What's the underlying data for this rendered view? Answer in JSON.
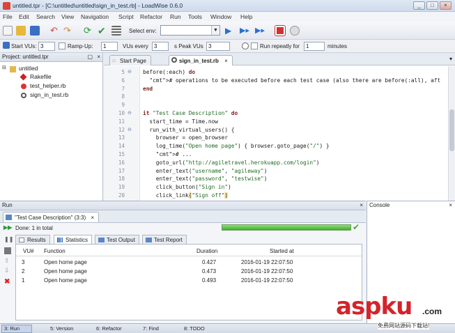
{
  "window": {
    "title": "untitled.tpr - [C:\\untitled\\untitled\\sign_in_test.rb] - LoadWise 0.6.0",
    "buttons": [
      "_",
      "□",
      "×"
    ]
  },
  "menu": [
    "File",
    "Edit",
    "Search",
    "View",
    "Navigation",
    "Script",
    "Refactor",
    "Run",
    "Tools",
    "Window",
    "Help"
  ],
  "toolbar": {
    "select_env_label": "Select env:"
  },
  "runbar": {
    "start_vus_label": "Start VUs:",
    "start_vus": "3",
    "ramp_up_label": "Ramp-Up:",
    "ramp_up": "1",
    "vus_every_label": "VUs every",
    "vus_every": "3",
    "peak_vus_label": "s  Peak VUs",
    "peak_vus": "3",
    "repeat_label": "Run repeatly for",
    "repeat_value": "1",
    "minutes_label": "minutes"
  },
  "project": {
    "header": "Project: untitled.tpr",
    "close": "×",
    "root": "untitled",
    "files": [
      "Rakefile",
      "test_helper.rb",
      "sign_in_test.rb"
    ]
  },
  "editor": {
    "tabs": [
      "Start Page",
      "sign_in_test.rb"
    ],
    "line_numbers": [
      "5",
      "6",
      "7",
      "8",
      "9",
      "10",
      "11",
      "12",
      "13",
      "14",
      "15",
      "16",
      "17",
      "18",
      "19",
      "20",
      "21"
    ],
    "lines": [
      "before(:each) do",
      "  # operations to be executed before each test case (also there are before(:all), aft",
      "end",
      "",
      "",
      "it \"Test Case Description\" do",
      "  start_time = Time.now",
      "  run_with_virtual_users() {",
      "    browser = open_browser",
      "    log_time(\"Open home page\") { browser.goto_page(\"/\") }",
      "    # ...",
      "    goto_url(\"http://agiletravel.herokuapp.com/login\")",
      "    enter_text(\"username\", \"agileway\")",
      "    enter_text(\"password\", \"testwise\")",
      "    click_button(\"Sign in\")",
      "    click_link(\"Sign off\")",
      "  }"
    ]
  },
  "run": {
    "header": "Run",
    "close": "×",
    "test_name": "\"Test Case Description\" (3:3)",
    "done": "Done: 1 in total",
    "progress_fraction": 1.0,
    "tabs": [
      "Results",
      "Statistics",
      "Test Output",
      "Test Report"
    ],
    "columns": [
      "VU#",
      "Function",
      "Duration",
      "Started at"
    ],
    "rows": [
      [
        "3",
        "Open home page",
        "0.427",
        "2016-01-19 22:07:50"
      ],
      [
        "2",
        "Open home page",
        "0.473",
        "2016-01-19 22:07:50"
      ],
      [
        "1",
        "Open home page",
        "0.493",
        "2016-01-19 22:07:50"
      ]
    ]
  },
  "console": {
    "header": "Console",
    "close": "×"
  },
  "statusbar": [
    "3: Run",
    "5: Version",
    "6: Refactor",
    "7: Find",
    "8: TODO"
  ],
  "watermark": {
    "brand": "aspku",
    "suffix": ".com",
    "tagline": "免费网站源码下载站!"
  },
  "colors": {
    "accent": "#3fae2c",
    "watermark_red": "#d3242a"
  }
}
